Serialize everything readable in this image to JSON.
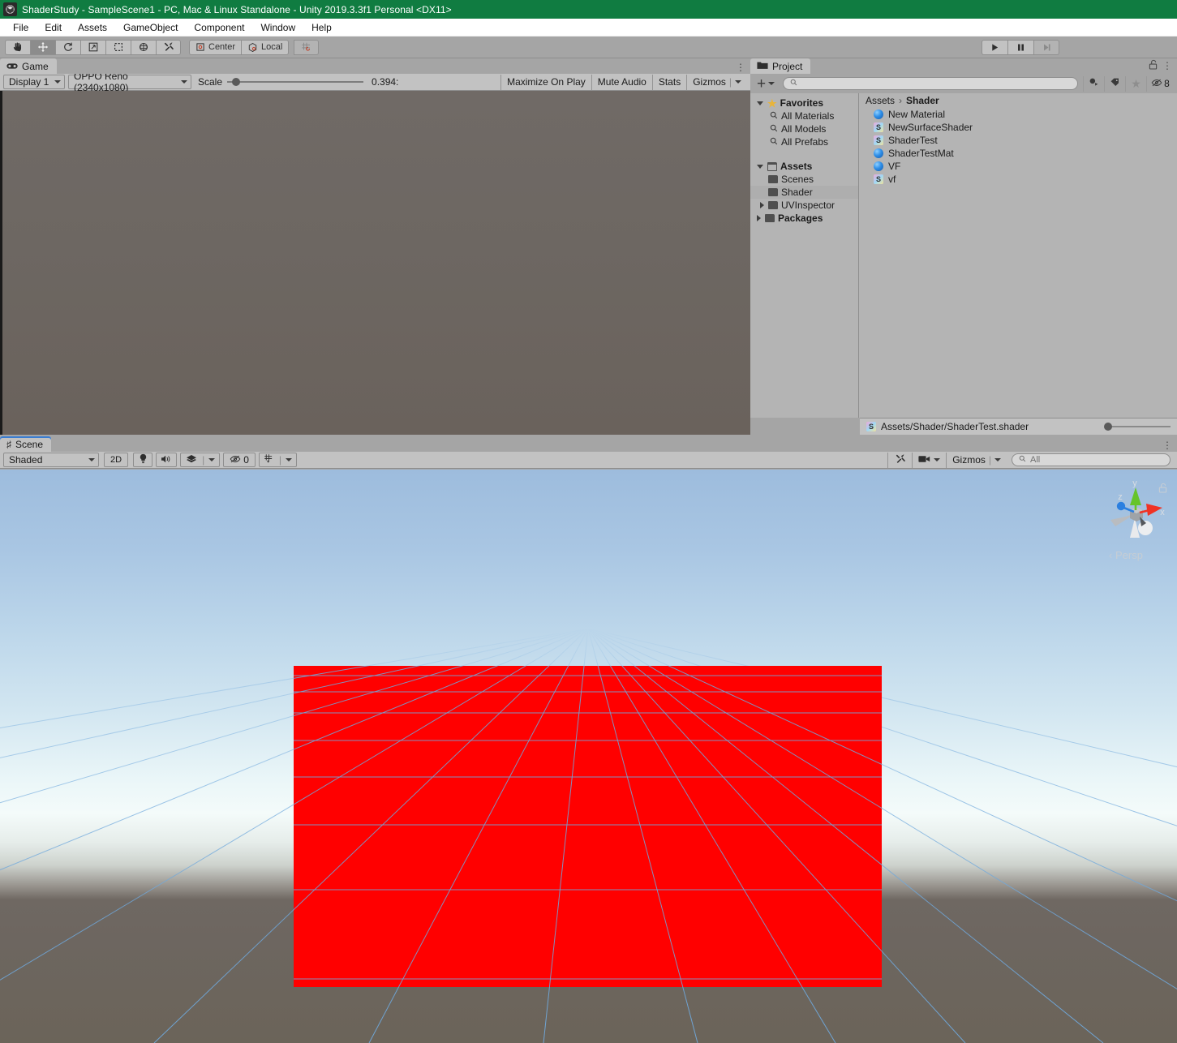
{
  "window": {
    "title": "ShaderStudy - SampleScene1 - PC, Mac & Linux Standalone - Unity 2019.3.3f1 Personal <DX11>",
    "icon": "unity-icon",
    "titlebar_color": "#107c41"
  },
  "menubar": {
    "items": [
      "File",
      "Edit",
      "Assets",
      "GameObject",
      "Component",
      "Window",
      "Help"
    ]
  },
  "toolbar": {
    "tools": [
      {
        "name": "hand-tool",
        "icon": "hand-icon",
        "active": false
      },
      {
        "name": "move-tool",
        "icon": "move-icon",
        "active": true
      },
      {
        "name": "rotate-tool",
        "icon": "rotate-icon",
        "active": false
      },
      {
        "name": "scale-tool",
        "icon": "scale-icon",
        "active": false
      },
      {
        "name": "rect-tool",
        "icon": "rect-icon",
        "active": false
      },
      {
        "name": "transform-tool",
        "icon": "transform-icon",
        "active": false
      },
      {
        "name": "custom-editor-tool",
        "icon": "wrench-icon",
        "active": false
      }
    ],
    "pivot_label": "Center",
    "handle_label": "Local",
    "grid_snap_icon": "grid-snap-icon",
    "playback": [
      {
        "name": "play-button",
        "icon": "play-icon"
      },
      {
        "name": "pause-button",
        "icon": "pause-icon"
      },
      {
        "name": "step-button",
        "icon": "step-icon"
      }
    ]
  },
  "game_panel": {
    "tab_label": "Game",
    "tab_icon": "gamepad-icon",
    "kebab": "⋮",
    "display_label": "Display 1",
    "resolution_label": "OPPO Reno (2340x1080)",
    "scale_label": "Scale",
    "scale_value": "0.394:",
    "scale_fraction": 6,
    "maximize_label": "Maximize On Play",
    "mute_label": "Mute Audio",
    "stats_label": "Stats",
    "gizmos_label": "Gizmos"
  },
  "project_panel": {
    "tab_label": "Project",
    "tab_icon": "folder-icon",
    "lock_icon": "lock-open-icon",
    "kebab": "⋮",
    "create_label": "+",
    "search_placeholder": "",
    "search_icon": "search-icon",
    "filters": [
      {
        "name": "filter-by-type-icon",
        "label": ""
      },
      {
        "name": "filter-by-label-icon",
        "label": ""
      },
      {
        "name": "favorite-star-icon",
        "label": ""
      },
      {
        "name": "visibility-count",
        "label": "8"
      }
    ],
    "tree": [
      {
        "label": "Favorites",
        "icon": "star-icon",
        "indent": 0,
        "bold": true,
        "twisty": "down"
      },
      {
        "label": "All Materials",
        "icon": "search-icon",
        "indent": 1,
        "bold": false,
        "twisty": "none"
      },
      {
        "label": "All Models",
        "icon": "search-icon",
        "indent": 1,
        "bold": false,
        "twisty": "none"
      },
      {
        "label": "All Prefabs",
        "icon": "search-icon",
        "indent": 1,
        "bold": false,
        "twisty": "none"
      },
      {
        "label": "",
        "icon": "spacer",
        "indent": 0,
        "bold": false,
        "twisty": "none"
      },
      {
        "label": "Assets",
        "icon": "folder-open-icon",
        "indent": 0,
        "bold": true,
        "twisty": "down"
      },
      {
        "label": "Scenes",
        "icon": "folder-icon",
        "indent": 1,
        "bold": false,
        "twisty": "none"
      },
      {
        "label": "Shader",
        "icon": "folder-icon",
        "indent": 1,
        "bold": false,
        "twisty": "none",
        "selected": true
      },
      {
        "label": "UVInspector",
        "icon": "folder-icon",
        "indent": 1,
        "bold": false,
        "twisty": "right"
      },
      {
        "label": "Packages",
        "icon": "folder-icon",
        "indent": 0,
        "bold": true,
        "twisty": "right"
      }
    ],
    "breadcrumb": {
      "root": "Assets",
      "separator": "›",
      "current": "Shader"
    },
    "assets": [
      {
        "label": "New Material",
        "icon": "material-icon"
      },
      {
        "label": "NewSurfaceShader",
        "icon": "shader-icon"
      },
      {
        "label": "ShaderTest",
        "icon": "shader-icon"
      },
      {
        "label": "ShaderTestMat",
        "icon": "material-icon"
      },
      {
        "label": "VF",
        "icon": "material-icon"
      },
      {
        "label": "vf",
        "icon": "shader-icon"
      }
    ],
    "status_path": "Assets/Shader/ShaderTest.shader",
    "status_icon": "shader-icon"
  },
  "scene_panel": {
    "tab_label": "Scene",
    "tab_icon": "hash-icon",
    "kebab": "⋮",
    "draw_mode": "Shaded",
    "two_d_label": "2D",
    "lighting_icon": "lightbulb-icon",
    "audio_icon": "speaker-icon",
    "fx_icon": "effects-icon",
    "hidden_count": "0",
    "hidden_icon": "eye-off-icon",
    "grid_icon": "grid-icon",
    "tools_icon": "wrench-icon",
    "camera_icon": "camera-icon",
    "gizmos_label": "Gizmos",
    "search_placeholder": "All",
    "search_icon": "search-icon",
    "gizmo": {
      "x_label": "x",
      "y_label": "y",
      "z_label": "z",
      "projection_label": "Persp",
      "lock_icon": "lock-open-icon",
      "x_color": "#f03224",
      "y_color": "#66c42a",
      "z_color": "#2b7fe0"
    },
    "objects": [
      {
        "name": "red-quad",
        "color": "#ff0000",
        "shape": "quad"
      }
    ],
    "grid_color": "#6fa8dc",
    "sky_top_color": "#9dbcdd",
    "ground_color": "#6d6660"
  }
}
